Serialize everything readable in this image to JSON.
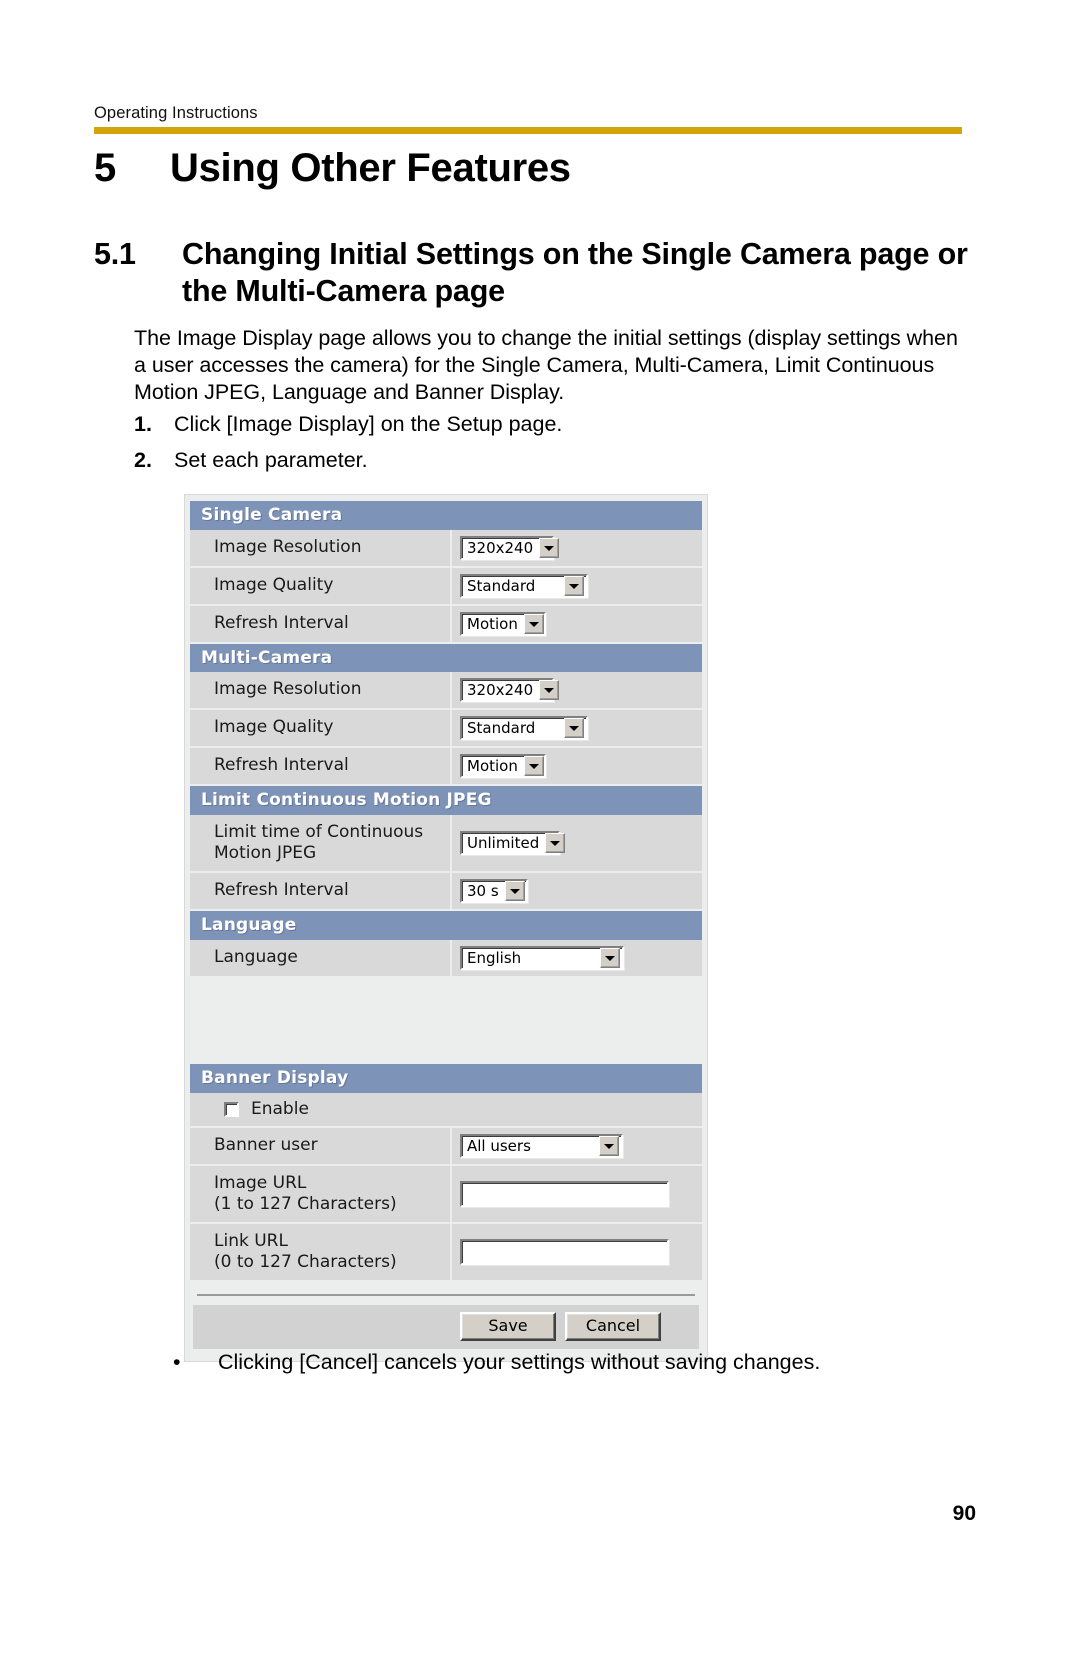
{
  "header": {
    "running_head": "Operating Instructions",
    "rule_color": "#d1a60b"
  },
  "chapter": {
    "number": "5",
    "title": "Using Other Features"
  },
  "section": {
    "number": "5.1",
    "title": "Changing Initial Settings on the Single Camera page or the Multi-Camera page"
  },
  "body": {
    "intro": "The Image Display page allows you to change the initial settings (display settings when a user accesses the camera) for the Single Camera, Multi-Camera, Limit Continuous Motion JPEG, Language and Banner Display.",
    "steps": [
      {
        "number": "1.",
        "text": "Click [Image Display] on the Setup page."
      },
      {
        "number": "2.",
        "text": "Set each parameter."
      }
    ],
    "note_bullet": "•",
    "note": "Clicking [Cancel] cancels your settings without saving changes."
  },
  "screenshot": {
    "accent_header_color": "#7e93b8",
    "row_bg_color": "#d9d9d9",
    "panel_bg_color": "#eceded",
    "groups": [
      {
        "title": "Single Camera",
        "rows": [
          {
            "label": "Image Resolution",
            "control": "select",
            "value": "320x240"
          },
          {
            "label": "Image Quality",
            "control": "select",
            "value": "Standard"
          },
          {
            "label": "Refresh Interval",
            "control": "select",
            "value": "Motion"
          }
        ]
      },
      {
        "title": "Multi-Camera",
        "rows": [
          {
            "label": "Image Resolution",
            "control": "select",
            "value": "320x240"
          },
          {
            "label": "Image Quality",
            "control": "select",
            "value": "Standard"
          },
          {
            "label": "Refresh Interval",
            "control": "select",
            "value": "Motion"
          }
        ]
      },
      {
        "title": "Limit Continuous Motion JPEG",
        "rows": [
          {
            "label": "Limit time of Continuous Motion JPEG",
            "control": "select",
            "value": "Unlimited"
          },
          {
            "label": "Refresh Interval",
            "control": "select",
            "value": "30 s"
          }
        ]
      },
      {
        "title": "Language",
        "rows": [
          {
            "label": "Language",
            "control": "select",
            "value": "English"
          }
        ]
      },
      {
        "title": "Banner Display",
        "rows": [
          {
            "label": "Enable",
            "control": "checkbox",
            "checked": false
          },
          {
            "label": "Banner user",
            "control": "select",
            "value": "All users"
          },
          {
            "label": "Image URL\n(1 to 127 Characters)",
            "control": "text",
            "value": ""
          },
          {
            "label": "Link URL\n(0 to 127 Characters)",
            "control": "text",
            "value": ""
          }
        ]
      }
    ],
    "labels": {
      "single_camera": "Single Camera",
      "multi_camera": "Multi-Camera",
      "limit_jpeg": "Limit Continuous Motion JPEG",
      "language_group": "Language",
      "banner_display": "Banner Display",
      "image_resolution": "Image Resolution",
      "image_quality": "Image Quality",
      "refresh_interval": "Refresh Interval",
      "limit_time_line1": "Limit time of Continuous",
      "limit_time_line2": "Motion JPEG",
      "language_row": "Language",
      "enable": "Enable",
      "banner_user": "Banner user",
      "image_url_line1": "Image URL",
      "image_url_line2": "(1 to 127 Characters)",
      "link_url_line1": "Link URL",
      "link_url_line2": "(0 to 127 Characters)"
    },
    "values": {
      "sc_resolution": "320x240",
      "sc_quality": "Standard",
      "sc_refresh": "Motion",
      "mc_resolution": "320x240",
      "mc_quality": "Standard",
      "mc_refresh": "Motion",
      "limit_time": "Unlimited",
      "limit_refresh": "30 s",
      "language": "English",
      "banner_user": "All users",
      "image_url": "",
      "link_url": ""
    },
    "buttons": {
      "save": "Save",
      "cancel": "Cancel"
    }
  },
  "footer": {
    "page_number": "90"
  }
}
